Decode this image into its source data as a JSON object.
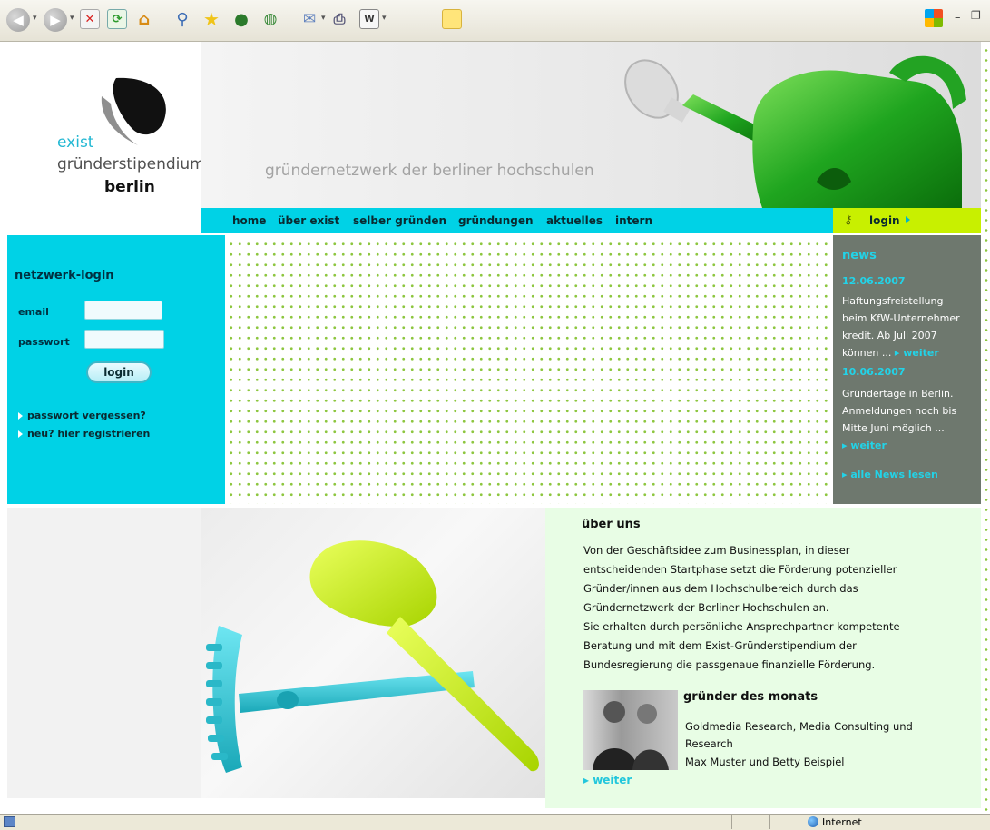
{
  "browser": {
    "status_zone": "Internet"
  },
  "logo": {
    "line1": "exist",
    "line2": "gründerstipendium",
    "line3": "berlin"
  },
  "banner": {
    "tagline": "gründernetzwerk der berliner hochschulen"
  },
  "nav": {
    "items": [
      "home",
      "über exist",
      "selber gründen",
      "gründungen",
      "aktuelles",
      "intern"
    ],
    "login": "login"
  },
  "login_panel": {
    "title": "netzwerk-login",
    "email_label": "email",
    "password_label": "passwort",
    "button": "login",
    "forgot": "passwort vergessen?",
    "register": "neu? hier registrieren"
  },
  "news": {
    "title": "news",
    "items": [
      {
        "date": "12.06.2007",
        "lines": [
          "Haftungsfreistellung",
          "beim KfW-Unternehmer",
          "kredit. Ab Juli 2007",
          "können ..."
        ],
        "more": "weiter"
      },
      {
        "date": "10.06.2007",
        "lines": [
          "Gründertage in Berlin.",
          "Anmeldungen noch bis",
          "Mitte Juni möglich ..."
        ],
        "more": "weiter"
      }
    ],
    "all": "alle News lesen"
  },
  "about": {
    "title": "über uns",
    "lines": [
      "Von der Geschäftsidee zum Businessplan, in dieser",
      "entscheidenden Startphase setzt die Förderung potenzieller",
      "Gründer/innen aus dem Hochschulbereich durch das",
      "Gründernetzwerk der Berliner Hochschulen an.",
      "Sie erhalten durch persönliche Ansprechpartner kompetente",
      "Beratung und mit dem Exist-Gründerstipendium der",
      "Bundesregierung die passgenaue finanzielle Förderung."
    ]
  },
  "founder": {
    "title": "gründer des monats",
    "lines": [
      "Goldmedia Research, Media Consulting und",
      "Research",
      "Max Muster und Betty Beispiel"
    ],
    "more": "weiter"
  },
  "colors": {
    "cyan": "#00d2e6",
    "lime": "#c8f000",
    "news_bg": "#6e786e",
    "about_bg": "#e8fde5",
    "dot_green": "#8dc63f"
  }
}
